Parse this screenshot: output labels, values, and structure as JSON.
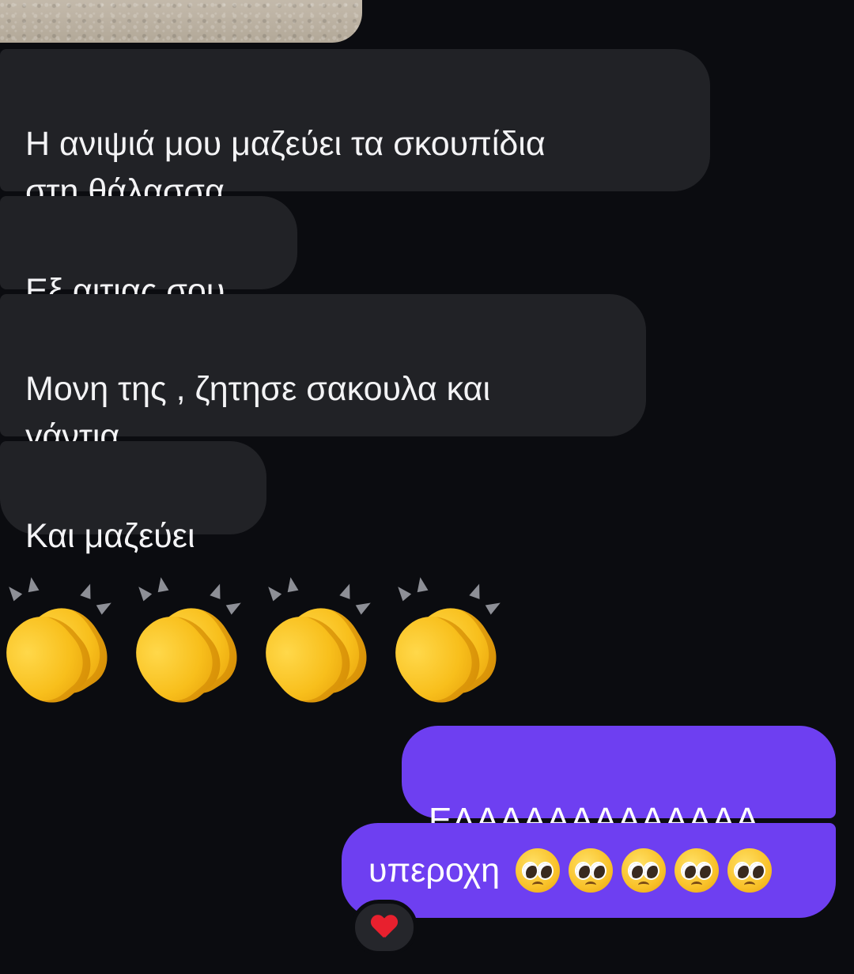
{
  "conversation": {
    "received_messages": [
      {
        "text": "Η ανιψιά μου μαζεύει τα σκουπίδια\nστη θάλασσα"
      },
      {
        "text": "Εξ αιτιας σου"
      },
      {
        "text": "Μονη της , ζητησε σακουλα και\nγάντια"
      },
      {
        "text": "Και μαζεύει"
      }
    ],
    "emoji_message": {
      "emoji": "clapping-hands",
      "count": 4
    },
    "sent_messages": [
      {
        "text": "ΕΛΑΑΑΑΑΑΑΑΑΑΑΑ"
      },
      {
        "text": "υπεροχη",
        "emoji": "pleading-face",
        "emoji_count": 5
      }
    ],
    "reaction": {
      "emoji": "red-heart"
    }
  },
  "colors": {
    "background": "#0b0c10",
    "received_bubble": "#212226",
    "sent_bubble": "#6e3ff1"
  }
}
